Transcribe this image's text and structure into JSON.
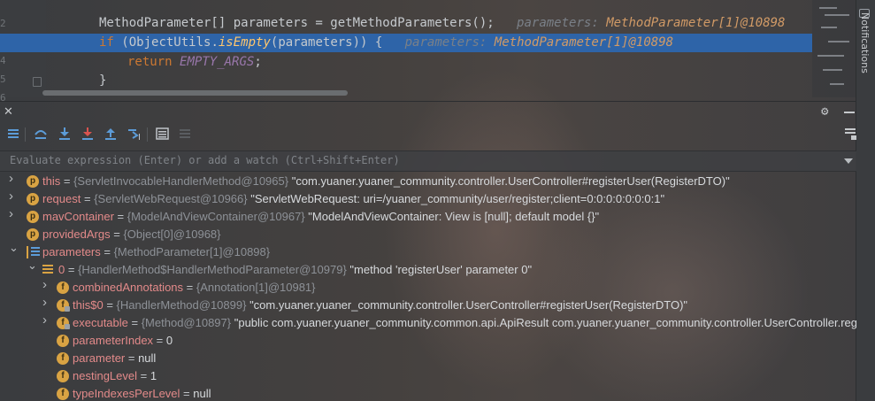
{
  "editor": {
    "gutter_numbers": [
      "2",
      "3",
      "4",
      "5",
      "6"
    ],
    "lines": [
      {
        "code_parts": [
          {
            "t": "MethodParameter[] parameters = getMethodParameters();",
            "c": "plain"
          }
        ],
        "inlay_label": "parameters:",
        "inlay_value": "MethodParameter[1]@10898",
        "highlight": false
      },
      {
        "code_parts": [
          {
            "t": "if ",
            "c": "kw"
          },
          {
            "t": "(ObjectUtils.",
            "c": "plain"
          },
          {
            "t": "isEmpty",
            "c": "fn"
          },
          {
            "t": "(parameters)) {",
            "c": "plain"
          }
        ],
        "inlay_label": "parameters:",
        "inlay_value": "MethodParameter[1]@10898",
        "highlight": true
      },
      {
        "code_parts": [
          {
            "t": "return ",
            "c": "kw"
          },
          {
            "t": "EMPTY_ARGS",
            "c": "const"
          },
          {
            "t": ";",
            "c": "plain"
          }
        ],
        "inlay_label": "",
        "inlay_value": "",
        "highlight": false
      },
      {
        "code_parts": [
          {
            "t": "}",
            "c": "plain"
          }
        ],
        "inlay_label": "",
        "inlay_value": "",
        "highlight": false
      }
    ]
  },
  "notifications": {
    "label": "Notifications"
  },
  "debug": {
    "evaluate_placeholder": "Evaluate expression (Enter) or add a watch (Ctrl+Shift+Enter)",
    "toolbar_icons": [
      "frames-icon",
      "step-over-icon",
      "step-into-icon",
      "force-step-into-icon",
      "step-out-icon",
      "run-to-cursor-icon",
      "evaluate-icon",
      "table-icon",
      "layout-icon"
    ],
    "variables": [
      {
        "name": "this",
        "ref": "{ServletInvocableHandlerMethod@10965}",
        "value": "\"com.yuaner.yuaner_community.controller.UserController#registerUser(RegisterDTO)\"",
        "depth": 0,
        "expandable": true,
        "expanded": false,
        "icon": "p"
      },
      {
        "name": "request",
        "ref": "{ServletWebRequest@10966}",
        "value": "\"ServletWebRequest: uri=/yuaner_community/user/register;client=0:0:0:0:0:0:0:1\"",
        "depth": 0,
        "expandable": true,
        "expanded": false,
        "icon": "p"
      },
      {
        "name": "mavContainer",
        "ref": "{ModelAndViewContainer@10967}",
        "value": "\"ModelAndViewContainer: View is [null]; default model {}\"",
        "depth": 0,
        "expandable": true,
        "expanded": false,
        "icon": "p"
      },
      {
        "name": "providedArgs",
        "ref": "{Object[0]@10968}",
        "value": "",
        "depth": 0,
        "expandable": false,
        "expanded": false,
        "icon": "p"
      },
      {
        "name": "parameters",
        "ref": "{MethodParameter[1]@10898}",
        "value": "",
        "depth": 0,
        "expandable": true,
        "expanded": true,
        "icon": "array"
      },
      {
        "name": "0",
        "ref": "{HandlerMethod$HandlerMethodParameter@10979}",
        "value": "\"method 'registerUser' parameter 0\"",
        "depth": 1,
        "expandable": true,
        "expanded": true,
        "icon": "eq"
      },
      {
        "name": "combinedAnnotations",
        "ref": "{Annotation[1]@10981}",
        "value": "",
        "depth": 2,
        "expandable": true,
        "expanded": false,
        "icon": "f"
      },
      {
        "name": "this$0",
        "ref": "{HandlerMethod@10899}",
        "value": "\"com.yuaner.yuaner_community.controller.UserController#registerUser(RegisterDTO)\"",
        "depth": 2,
        "expandable": true,
        "expanded": false,
        "icon": "flock"
      },
      {
        "name": "executable",
        "ref": "{Method@10897}",
        "value": "\"public com.yuaner.yuaner_community.common.api.ApiResult com.yuaner.yuaner_community.controller.UserController.regi",
        "depth": 2,
        "expandable": true,
        "expanded": false,
        "icon": "flock"
      },
      {
        "name": "parameterIndex",
        "ref": "",
        "value": "0",
        "depth": 2,
        "expandable": false,
        "expanded": false,
        "icon": "f"
      },
      {
        "name": "parameter",
        "ref": "",
        "value": "null",
        "depth": 2,
        "expandable": false,
        "expanded": false,
        "icon": "f"
      },
      {
        "name": "nestingLevel",
        "ref": "",
        "value": "1",
        "depth": 2,
        "expandable": false,
        "expanded": false,
        "icon": "f"
      },
      {
        "name": "typeIndexesPerLevel",
        "ref": "",
        "value": "null",
        "depth": 2,
        "expandable": false,
        "expanded": false,
        "icon": "f"
      }
    ]
  }
}
